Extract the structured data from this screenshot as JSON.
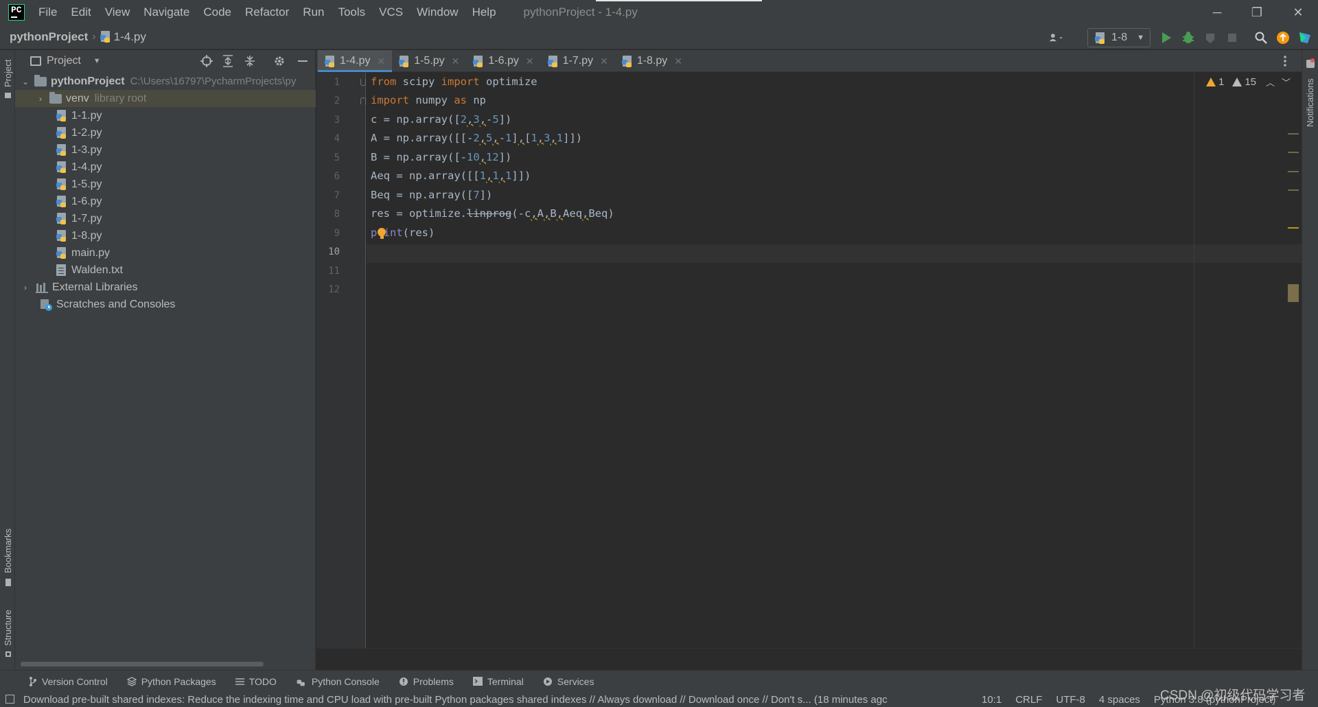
{
  "window": {
    "title": "pythonProject - 1-4.py",
    "minimize_glyph": "─",
    "restore_glyph": "❐",
    "close_glyph": "✕"
  },
  "menu": [
    "File",
    "Edit",
    "View",
    "Navigate",
    "Code",
    "Refactor",
    "Run",
    "Tools",
    "VCS",
    "Window",
    "Help"
  ],
  "navbar": {
    "project": "pythonProject",
    "file": "1-4.py",
    "run_config": "1-8"
  },
  "project_panel": {
    "title": "Project",
    "root_name": "pythonProject",
    "root_path": "C:\\Users\\16797\\PycharmProjects\\py",
    "venv": "venv",
    "venv_note": "library root",
    "files": [
      "1-1.py",
      "1-2.py",
      "1-3.py",
      "1-4.py",
      "1-5.py",
      "1-6.py",
      "1-7.py",
      "1-8.py",
      "main.py",
      "Walden.txt"
    ],
    "external_libraries": "External Libraries",
    "scratches": "Scratches and Consoles"
  },
  "tabs": [
    {
      "label": "1-4.py",
      "active": true
    },
    {
      "label": "1-5.py",
      "active": false
    },
    {
      "label": "1-6.py",
      "active": false
    },
    {
      "label": "1-7.py",
      "active": false
    },
    {
      "label": "1-8.py",
      "active": false
    }
  ],
  "editor": {
    "line_numbers": [
      "1",
      "2",
      "3",
      "4",
      "5",
      "6",
      "7",
      "8",
      "9",
      "10",
      "11",
      "12"
    ],
    "warnings_count": "1",
    "weak_warnings_count": "15"
  },
  "left_strip": {
    "project": "Project",
    "bookmarks": "Bookmarks",
    "structure": "Structure"
  },
  "right_strip": {
    "notifications": "Notifications"
  },
  "bottom_tools": [
    "Version Control",
    "Python Packages",
    "TODO",
    "Python Console",
    "Problems",
    "Terminal",
    "Services"
  ],
  "status": {
    "message": "Download pre-built shared indexes: Reduce the indexing time and CPU load with pre-built Python packages shared indexes // Always download // Download once // Don't s... (18 minutes agc",
    "position": "10:1",
    "line_sep": "CRLF",
    "encoding": "UTF-8",
    "indent": "4 spaces",
    "interpreter": "Python 3.8 (pythonProject)"
  },
  "watermark": "CSDN @初级代码学习者",
  "colors": {
    "accent": "#4a88c7",
    "keyword": "#cc7832",
    "number": "#6897bb",
    "warning": "#f0a732"
  }
}
